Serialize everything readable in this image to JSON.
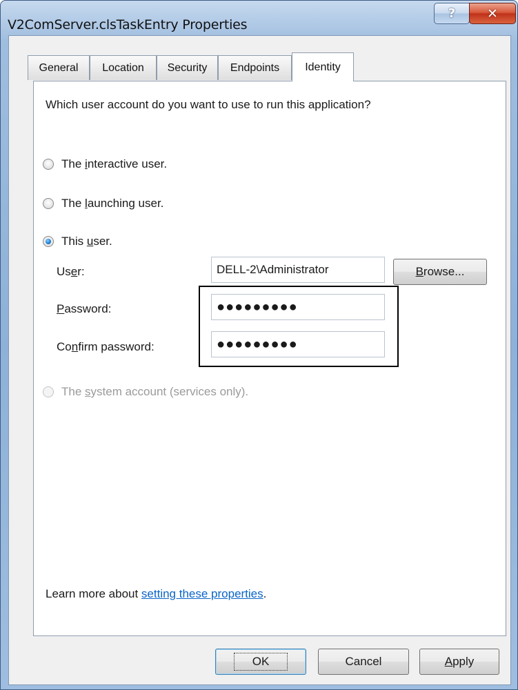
{
  "window": {
    "title": "V2ComServer.clsTaskEntry Properties",
    "help_glyph": "?",
    "close_glyph": "✕"
  },
  "tabs": [
    {
      "label": "General"
    },
    {
      "label": "Location"
    },
    {
      "label": "Security"
    },
    {
      "label": "Endpoints"
    },
    {
      "label": "Identity",
      "selected": true
    }
  ],
  "identity": {
    "question": "Which user account do you want to use to run this application?",
    "options": [
      {
        "pre": "The ",
        "key": "i",
        "post": "nteractive user.",
        "checked": false,
        "enabled": true
      },
      {
        "pre": "The ",
        "key": "l",
        "post": "aunching user.",
        "checked": false,
        "enabled": true
      },
      {
        "pre": "This ",
        "key": "u",
        "post": "ser.",
        "checked": true,
        "enabled": true
      },
      {
        "pre": "The ",
        "key": "s",
        "post": "ystem account (services only).",
        "checked": false,
        "enabled": false
      }
    ],
    "user_label": {
      "pre": "Us",
      "key": "e",
      "post": "r:"
    },
    "user_value": "DELL-2\\Administrator",
    "browse_label": {
      "pre": "",
      "key": "B",
      "post": "rowse..."
    },
    "password_label": {
      "pre": "",
      "key": "P",
      "post": "assword:"
    },
    "password_value": "●●●●●●●●●",
    "confirm_label": {
      "pre": "Co",
      "key": "n",
      "post": "firm password:"
    },
    "confirm_value": "●●●●●●●●●",
    "learn_prefix": "Learn more about ",
    "learn_link": "setting these properties",
    "learn_suffix": "."
  },
  "footer": {
    "ok": "OK",
    "cancel": "Cancel",
    "apply": {
      "pre": "",
      "key": "A",
      "post": "pply"
    }
  },
  "colors": {
    "link": "#0a64c8",
    "radio_selected": "#1d7fd6",
    "close_button": "#c0321b"
  }
}
